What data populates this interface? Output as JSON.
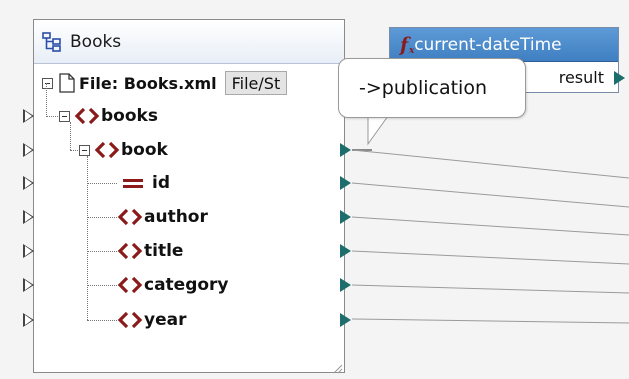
{
  "source_component": {
    "title": "Books",
    "icon": "xml-schema-icon",
    "file_label": "File: Books.xml",
    "file_button_label": "File/St"
  },
  "tree": {
    "root": {
      "label": "books",
      "icon": "element-icon"
    },
    "book": {
      "label": "book",
      "icon": "element-icon"
    },
    "children": [
      {
        "label": "id",
        "icon": "attribute-icon"
      },
      {
        "label": "author",
        "icon": "element-icon"
      },
      {
        "label": "title",
        "icon": "element-icon"
      },
      {
        "label": "category",
        "icon": "element-icon"
      },
      {
        "label": "year",
        "icon": "element-icon"
      }
    ]
  },
  "function_component": {
    "icon": "function-icon",
    "title": "current-dateTime",
    "output_label": "result"
  },
  "tooltip": {
    "text": "->publication"
  },
  "colors": {
    "element_icon": "#8b1a1a",
    "output_port": "#1c6d6b",
    "function_header": "#4a8ace",
    "wire": "#8a8a8a"
  }
}
